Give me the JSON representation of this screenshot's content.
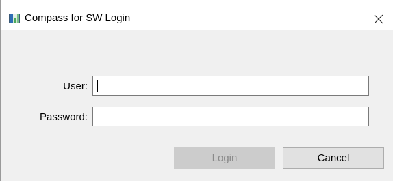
{
  "window": {
    "title": "Compass for SW Login",
    "icon": "app-chart-icon",
    "close_icon": "close-icon"
  },
  "form": {
    "user_label": "User:",
    "user_value": "",
    "password_label": "Password:",
    "password_value": ""
  },
  "buttons": {
    "login_label": "Login",
    "login_enabled": false,
    "cancel_label": "Cancel"
  },
  "colors": {
    "dialog_background": "#f0f0f0",
    "titlebar_background": "#ffffff",
    "disabled_button": "#cccccc",
    "disabled_text": "#8a8a8a"
  }
}
